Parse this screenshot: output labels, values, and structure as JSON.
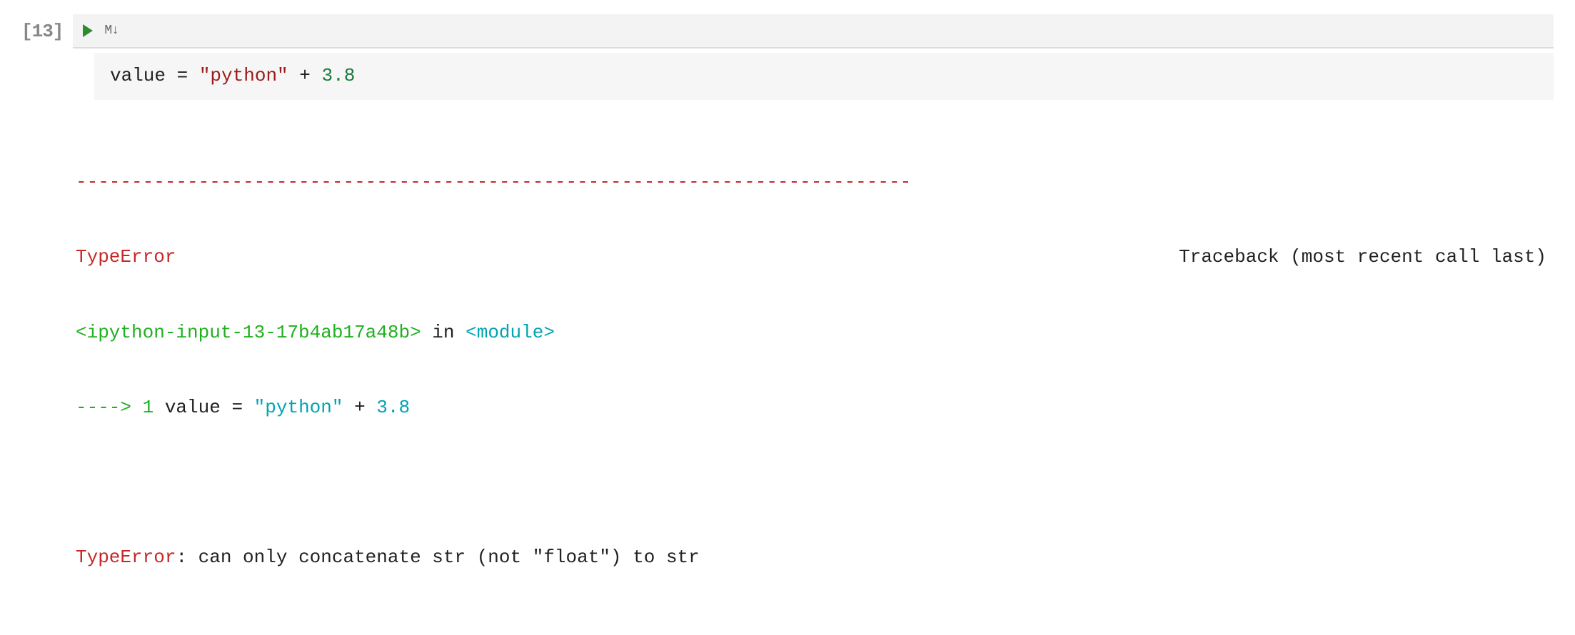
{
  "cell": {
    "prompt_number": "[13]",
    "markdown_label": "M↓",
    "code": {
      "var": "value",
      "op": " = ",
      "str": "\"python\"",
      "plus": " + ",
      "num_int": "3",
      "dot": ".",
      "num_dec": "8"
    }
  },
  "output": {
    "dashes": "---------------------------------------------------------------------------",
    "error_type": "TypeError",
    "traceback_header": "Traceback (most recent call last)",
    "input_ref": "<ipython-input-13-17b4ab17a48b>",
    "in_text": " in ",
    "module_text": "<module>",
    "arrow": "----> 1",
    "tb_var": " value ",
    "tb_eq": "=",
    "tb_sp": " ",
    "tb_str": "\"python\"",
    "tb_plus": " + ",
    "tb_float": "3.8",
    "error_type2": "TypeError",
    "error_message": ": can only concatenate str (not \"float\") to str"
  }
}
